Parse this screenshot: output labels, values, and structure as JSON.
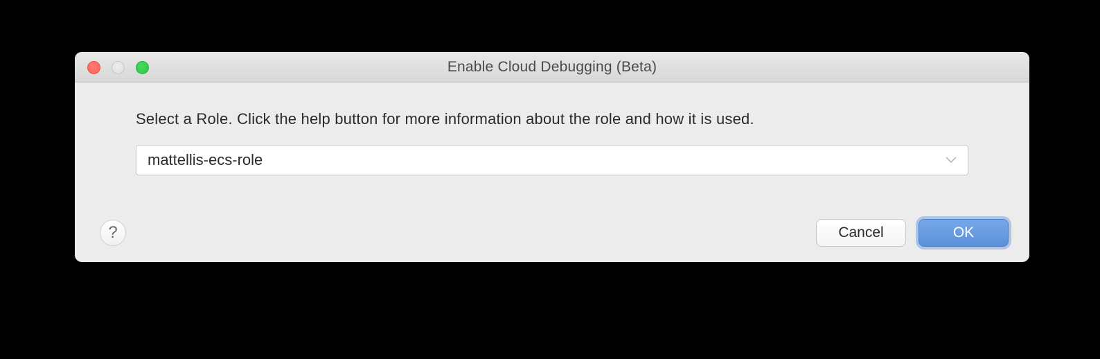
{
  "window": {
    "title": "Enable Cloud Debugging (Beta)"
  },
  "content": {
    "instruction": "Select a Role. Click the help button for more information about the role and how it is used.",
    "role_select": {
      "selected": "mattellis-ecs-role"
    }
  },
  "footer": {
    "help_label": "?",
    "cancel_label": "Cancel",
    "ok_label": "OK"
  }
}
